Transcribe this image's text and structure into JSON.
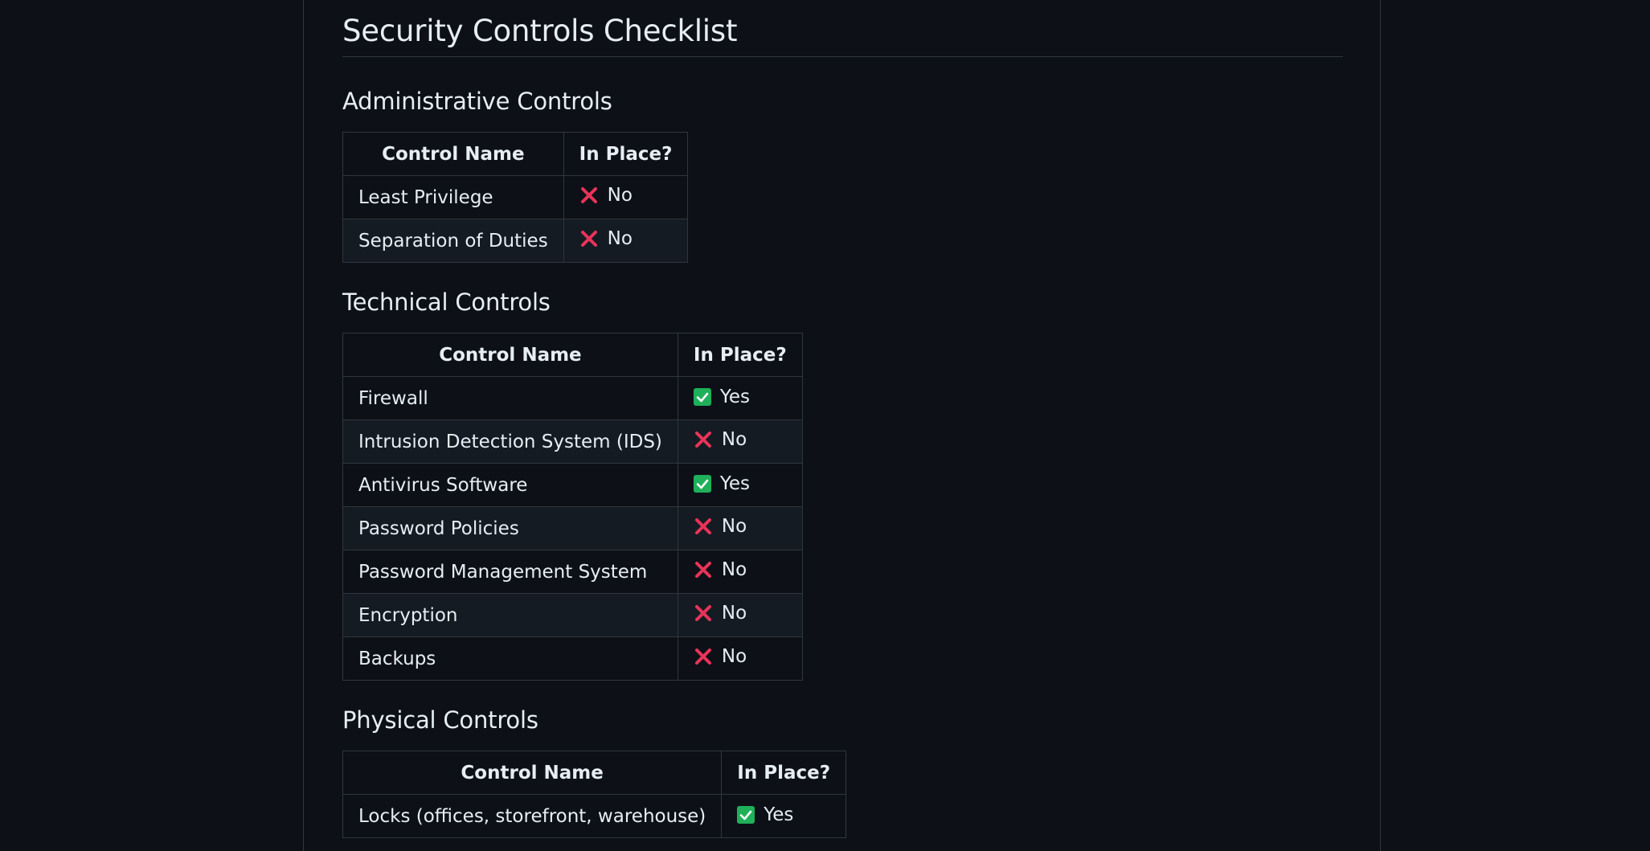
{
  "title": "Security Controls Checklist",
  "columns": {
    "name": "Control Name",
    "status": "In Place?"
  },
  "status_labels": {
    "yes": "Yes",
    "no": "No"
  },
  "colors": {
    "yes": "#1fb05a",
    "no": "#e8345a"
  },
  "sections": [
    {
      "heading": "Administrative Controls",
      "rows": [
        {
          "name": "Least Privilege",
          "status": "No",
          "icon": "cross-mark-icon"
        },
        {
          "name": "Separation of Duties",
          "status": "No",
          "icon": "cross-mark-icon"
        }
      ]
    },
    {
      "heading": "Technical Controls",
      "rows": [
        {
          "name": "Firewall",
          "status": "Yes",
          "icon": "check-box-icon"
        },
        {
          "name": "Intrusion Detection System (IDS)",
          "status": "No",
          "icon": "cross-mark-icon"
        },
        {
          "name": "Antivirus Software",
          "status": "Yes",
          "icon": "check-box-icon"
        },
        {
          "name": "Password Policies",
          "status": "No",
          "icon": "cross-mark-icon"
        },
        {
          "name": "Password Management System",
          "status": "No",
          "icon": "cross-mark-icon"
        },
        {
          "name": "Encryption",
          "status": "No",
          "icon": "cross-mark-icon"
        },
        {
          "name": "Backups",
          "status": "No",
          "icon": "cross-mark-icon"
        }
      ]
    },
    {
      "heading": "Physical Controls",
      "rows": [
        {
          "name": "Locks (offices, storefront, warehouse)",
          "status": "Yes",
          "icon": "check-box-icon"
        }
      ]
    }
  ]
}
